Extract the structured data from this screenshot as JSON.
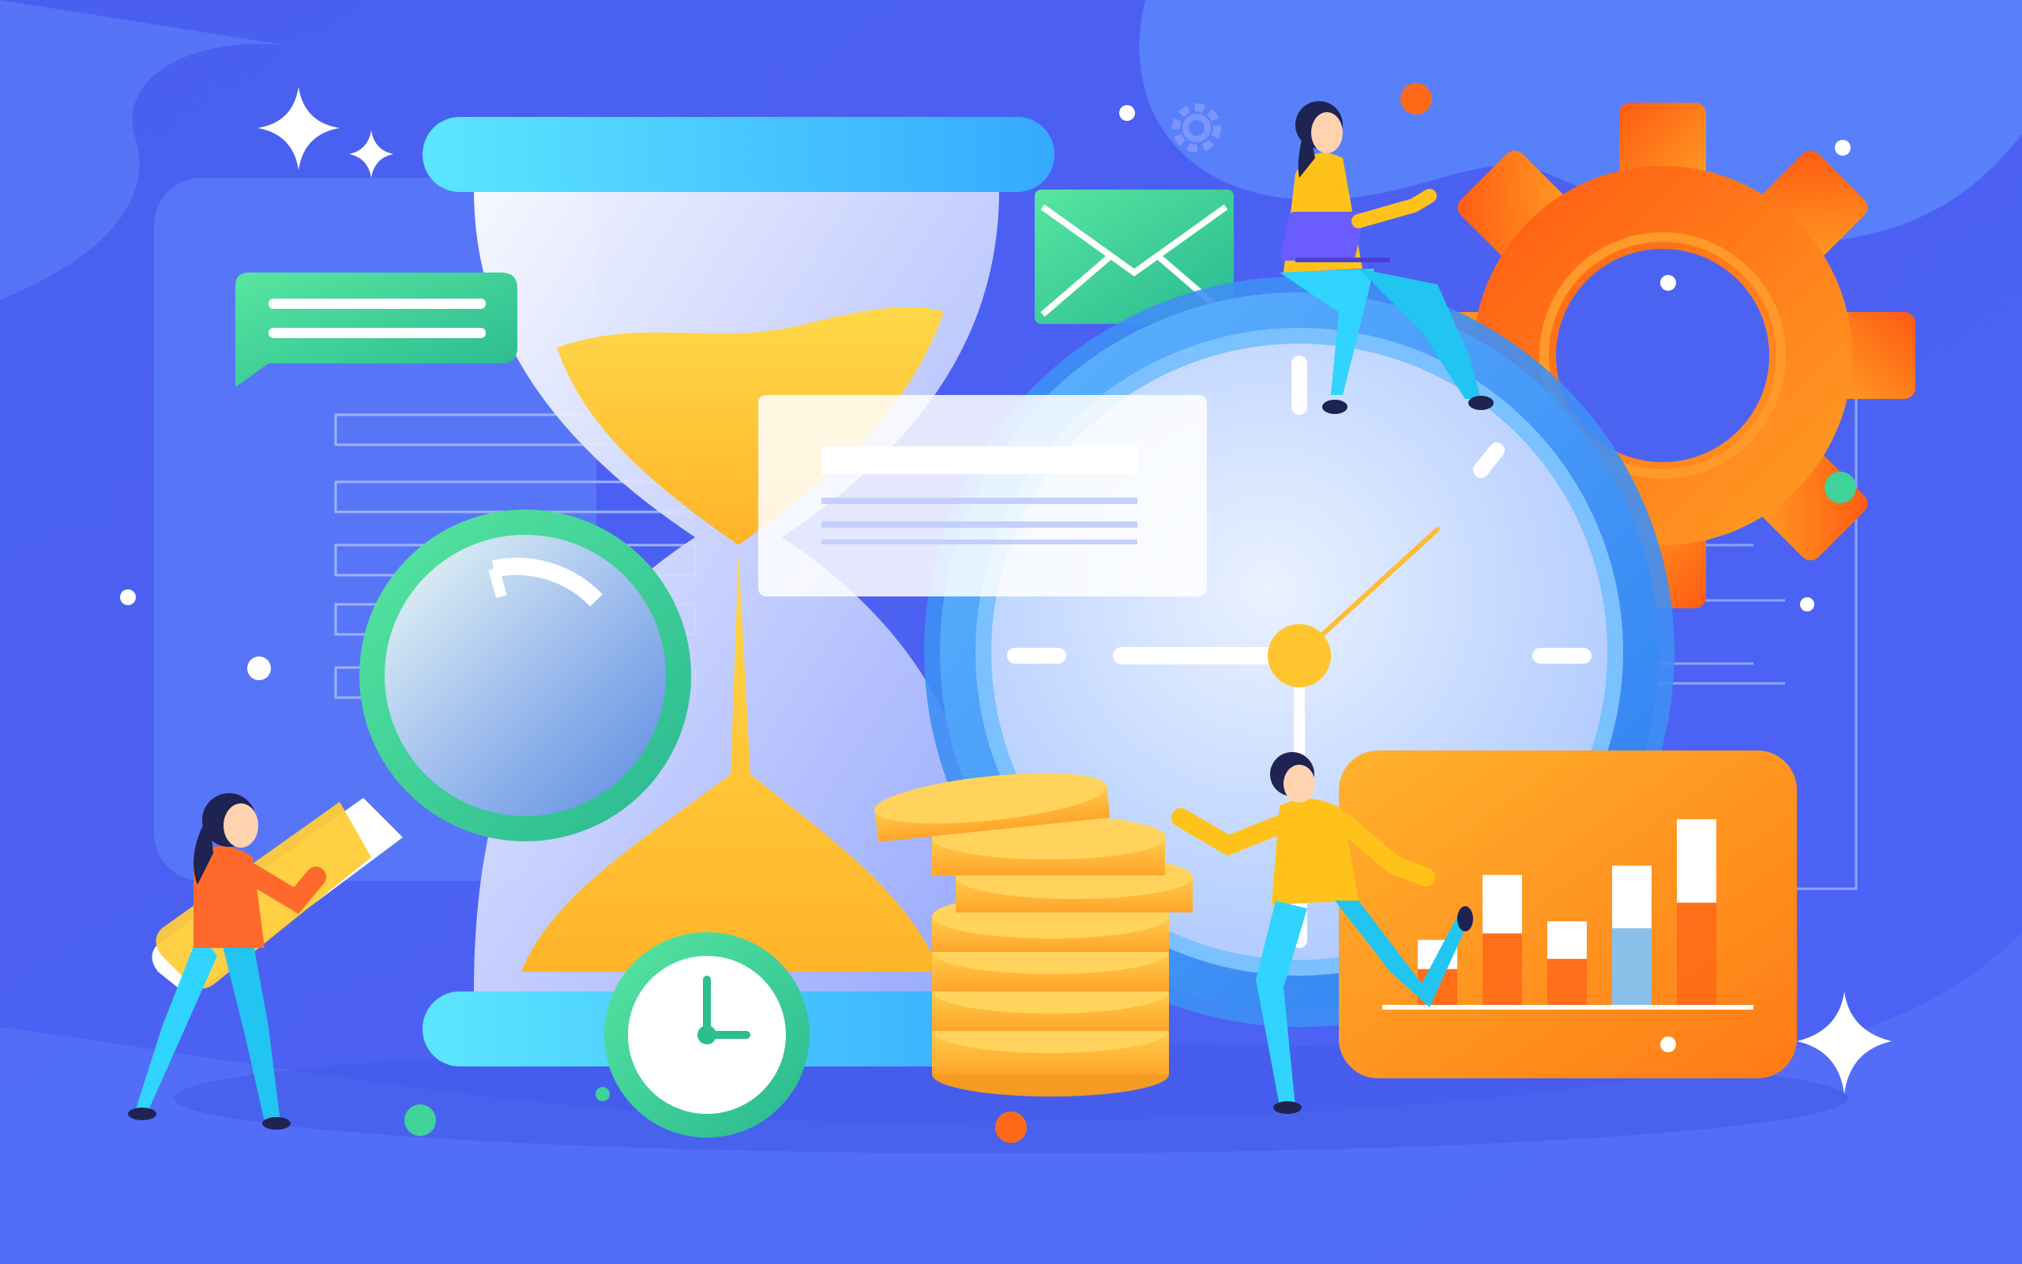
{
  "palette": {
    "background": "#4c63f2",
    "background_light": "#5b7cf8",
    "panel": "#5b76f7",
    "cyan": "#5fe0ff",
    "green": "#3fd39a",
    "yellow": "#ffcc33",
    "orange": "#ff7a1a",
    "white": "#ffffff"
  },
  "illustration": {
    "elements": [
      "hourglass",
      "clock",
      "magnifying-glass",
      "gear",
      "coin-stack",
      "envelope",
      "chat-bubble",
      "bar-chart-card",
      "small-clock",
      "sparkles",
      "person-woman-with-magnifier",
      "person-woman-with-laptop",
      "person-man-running"
    ],
    "bar_chart_levels": [
      0.35,
      0.7,
      0.45,
      0.75,
      1.0
    ]
  }
}
